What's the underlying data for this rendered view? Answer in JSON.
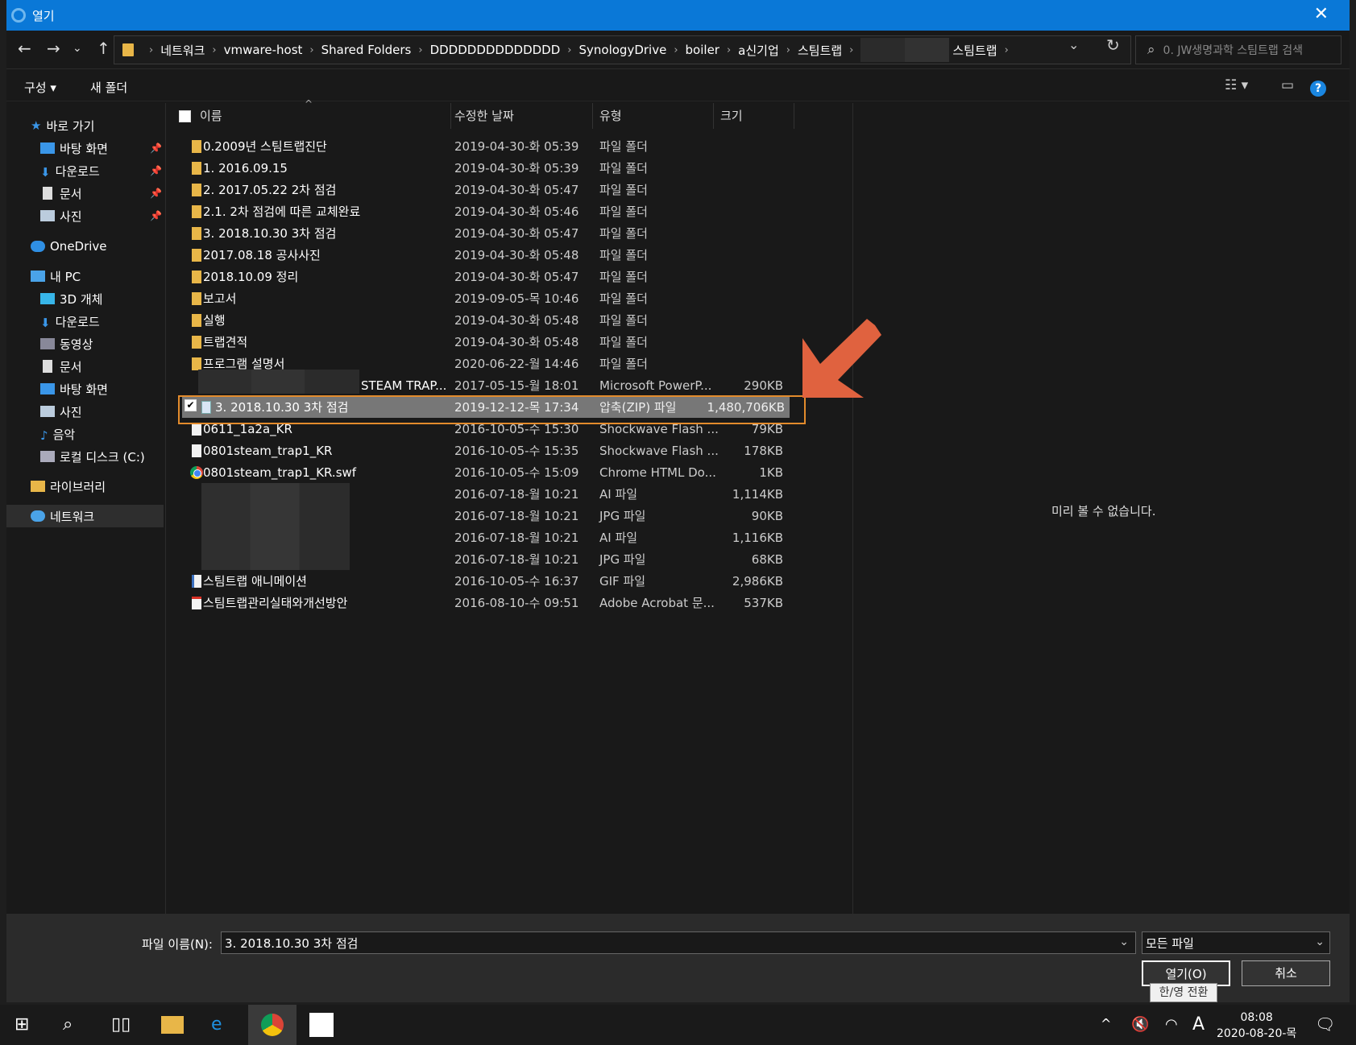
{
  "window": {
    "title": "열기",
    "close": "✕"
  },
  "address": {
    "crumbs": [
      "네트워크",
      "vmware-host",
      "Shared Folders",
      "DDDDDDDDDDDDDD",
      "SynologyDrive",
      "boiler",
      "a신기업",
      "스팀트랩"
    ],
    "last_crumb": "스팀트랩",
    "search_placeholder": "0. JW생명과학 스팀트랩 검색"
  },
  "toolbar": {
    "organize": "구성 ▾",
    "new_folder": "새 폴더"
  },
  "sidebar": {
    "quick": "바로 가기",
    "quick_items": [
      "바탕 화면",
      "다운로드",
      "문서",
      "사진"
    ],
    "onedrive": "OneDrive",
    "pc": "내 PC",
    "pc_items": [
      "3D 개체",
      "다운로드",
      "동영상",
      "문서",
      "바탕 화면",
      "사진",
      "음악",
      "로컬 디스크 (C:)"
    ],
    "library": "라이브러리",
    "network": "네트워크"
  },
  "columns": {
    "name": "이름",
    "date": "수정한 날짜",
    "type": "유형",
    "size": "크기"
  },
  "files": [
    {
      "name": "0.2009년 스팀트랩진단",
      "date": "2019-04-30-화 05:39",
      "type": "파일 폴더",
      "size": ""
    },
    {
      "name": "1. 2016.09.15",
      "date": "2019-04-30-화 05:39",
      "type": "파일 폴더",
      "size": ""
    },
    {
      "name": "2. 2017.05.22 2차 점검",
      "date": "2019-04-30-화 05:47",
      "type": "파일 폴더",
      "size": ""
    },
    {
      "name": "2.1. 2차 점검에 따른 교체완료",
      "date": "2019-04-30-화 05:46",
      "type": "파일 폴더",
      "size": ""
    },
    {
      "name": "3. 2018.10.30 3차 점검",
      "date": "2019-04-30-화 05:47",
      "type": "파일 폴더",
      "size": ""
    },
    {
      "name": "2017.08.18 공사사진",
      "date": "2019-04-30-화 05:48",
      "type": "파일 폴더",
      "size": ""
    },
    {
      "name": "2018.10.09 정리",
      "date": "2019-04-30-화 05:47",
      "type": "파일 폴더",
      "size": ""
    },
    {
      "name": "보고서",
      "date": "2019-09-05-목 10:46",
      "type": "파일 폴더",
      "size": ""
    },
    {
      "name": "실행",
      "date": "2019-04-30-화 05:48",
      "type": "파일 폴더",
      "size": ""
    },
    {
      "name": "트랩견적",
      "date": "2019-04-30-화 05:48",
      "type": "파일 폴더",
      "size": ""
    },
    {
      "name": "프로그램 설명서",
      "date": "2020-06-22-월 14:46",
      "type": "파일 폴더",
      "size": ""
    },
    {
      "name": "STEAM TRAP...",
      "date": "2017-05-15-월 18:01",
      "type": "Microsoft PowerP...",
      "size": "290KB"
    },
    {
      "name": "3. 2018.10.30 3차 점검",
      "date": "2019-12-12-목 17:34",
      "type": "압축(ZIP) 파일",
      "size": "1,480,706KB"
    },
    {
      "name": "0611_1a2a_KR",
      "date": "2016-10-05-수 15:30",
      "type": "Shockwave Flash ...",
      "size": "79KB"
    },
    {
      "name": "0801steam_trap1_KR",
      "date": "2016-10-05-수 15:35",
      "type": "Shockwave Flash ...",
      "size": "178KB"
    },
    {
      "name": "0801steam_trap1_KR.swf",
      "date": "2016-10-05-수 15:09",
      "type": "Chrome HTML Do...",
      "size": "1KB"
    },
    {
      "name": "",
      "date": "2016-07-18-월 10:21",
      "type": "AI 파일",
      "size": "1,114KB"
    },
    {
      "name": "",
      "date": "2016-07-18-월 10:21",
      "type": "JPG 파일",
      "size": "90KB"
    },
    {
      "name": "",
      "date": "2016-07-18-월 10:21",
      "type": "AI 파일",
      "size": "1,116KB"
    },
    {
      "name": "",
      "date": "2016-07-18-월 10:21",
      "type": "JPG 파일",
      "size": "68KB"
    },
    {
      "name": "스팀트랩 애니메이션",
      "date": "2016-10-05-수 16:37",
      "type": "GIF 파일",
      "size": "2,986KB"
    },
    {
      "name": "스팀트랩관리실태와개선방안",
      "date": "2016-08-10-수 09:51",
      "type": "Adobe Acrobat 문...",
      "size": "537KB"
    }
  ],
  "preview": "미리 볼 수 없습니다.",
  "bottom": {
    "filename_label": "파일 이름(N):",
    "filename_value": "3. 2018.10.30 3차 점검",
    "filetype": "모든 파일",
    "open": "열기(O)",
    "cancel": "취소",
    "tooltip": "한/영 전환"
  },
  "taskbar": {
    "time": "08:08",
    "date": "2020-08-20-목",
    "ime": "A"
  },
  "colors": {
    "accent": "#0a78d7",
    "highlight": "#e38b2c",
    "arrow": "#e0623f"
  }
}
